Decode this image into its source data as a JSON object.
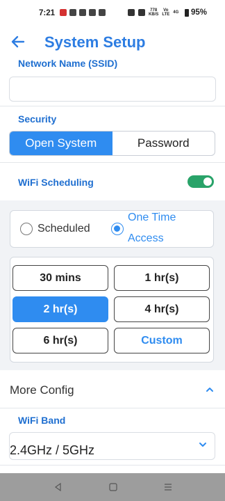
{
  "status_bar": {
    "time": "7:21",
    "speed_top": "778",
    "speed_bottom": "KB/S",
    "volte_top": "Vo",
    "volte_bottom": "LTE",
    "network": "4G",
    "battery": "95%"
  },
  "header": {
    "title": "System Setup",
    "back_icon": "arrow-left-icon"
  },
  "network_name": {
    "label": "Network Name (SSID)",
    "value": ""
  },
  "security": {
    "label": "Security",
    "options": [
      "Open System",
      "Password"
    ],
    "selected": "Open System"
  },
  "wifi_scheduling": {
    "label": "WiFi Scheduling",
    "enabled": true,
    "modes": [
      "Scheduled",
      "One Time Access"
    ],
    "selected_mode": "One Time Access",
    "durations": [
      "30 mins",
      "1 hr(s)",
      "2 hr(s)",
      "4 hr(s)",
      "6 hr(s)",
      "Custom"
    ],
    "selected_duration": "2 hr(s)"
  },
  "more_config": {
    "label": "More Config",
    "expanded": true
  },
  "wifi_band": {
    "label": "WiFi Band",
    "value": "2.4GHz / 5GHz"
  },
  "colors": {
    "accent": "#2f8cf0",
    "title": "#2d7de2",
    "label": "#1f6fd0",
    "toggle_on": "#29a369"
  }
}
